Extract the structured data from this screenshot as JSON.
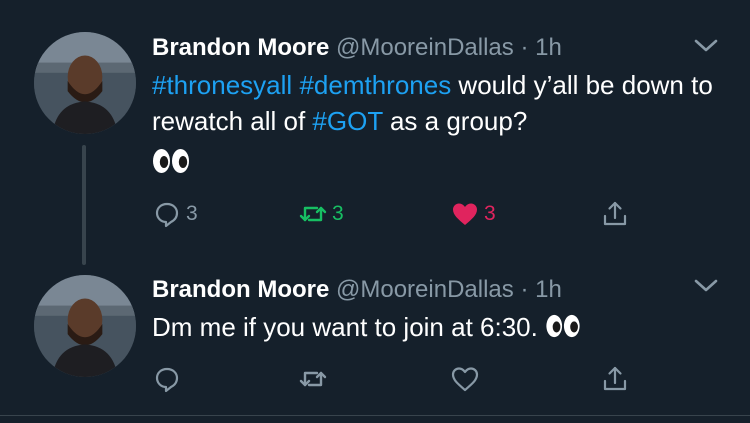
{
  "tweets": [
    {
      "name": "Brandon Moore",
      "handle": "@MooreinDallas",
      "separator": "·",
      "time": "1h",
      "hashtag_1": "#thronesyall",
      "hashtag_2": "#demthrones",
      "text_1": " would y’all be down to rewatch all of ",
      "hashtag_3": "#GOT",
      "text_2": " as a group?",
      "emoji": "eyes-emoji",
      "reply_count": "3",
      "retweet_count": "3",
      "like_count": "3",
      "retweeted": true,
      "liked": true
    },
    {
      "name": "Brandon Moore",
      "handle": "@MooreinDallas",
      "separator": "·",
      "time": "1h",
      "text": "Dm me if you want to join at 6:30. ",
      "emoji": "eyes-emoji",
      "reply_count": "",
      "retweet_count": "",
      "like_count": "",
      "retweeted": false,
      "liked": false
    }
  ],
  "icons": {
    "reply": "reply-icon",
    "retweet": "retweet-icon",
    "like": "heart-icon",
    "share": "share-icon",
    "caret": "chevron-down-icon"
  },
  "colors": {
    "background": "#15202b",
    "hashtag": "#1da1f2",
    "muted": "#8899a6",
    "retweet_active": "#17bf63",
    "like_active": "#e0245e",
    "divider": "#38444d"
  }
}
